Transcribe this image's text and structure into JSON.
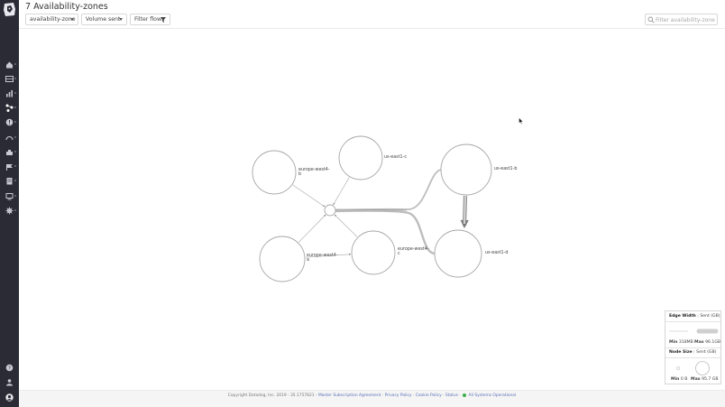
{
  "page": {
    "title": "7 Availability-zones"
  },
  "toolbar": {
    "group_by": "availability-zone",
    "metric": "Volume sent",
    "filter_label": "Filter flows",
    "search_placeholder": "Filter availability-zones"
  },
  "sidebar": {
    "icons": [
      "home-icon",
      "monitor-icon",
      "dashboard-icon",
      "network-icon",
      "security-icon",
      "apm-icon",
      "integrations-icon",
      "synthetics-icon",
      "logs-icon",
      "notebooks-icon",
      "settings-icon"
    ],
    "bottom_icons": [
      "help-icon",
      "team-icon",
      "user-icon"
    ]
  },
  "graph": {
    "nodes": [
      {
        "name": "europe-west4-b",
        "label_lines": [
          "europe-west4-",
          "b"
        ]
      },
      {
        "name": "us-east1-c",
        "label_lines": [
          "us-east1-c"
        ]
      },
      {
        "name": "us-east1-b",
        "label_lines": [
          "us-east1-b"
        ]
      },
      {
        "name": "europe-west4-a",
        "label_lines": [
          "europe-west4-",
          "a"
        ]
      },
      {
        "name": "europe-west4-c",
        "label_lines": [
          "europe-west4-",
          "c"
        ]
      },
      {
        "name": "us-east1-d",
        "label_lines": [
          "us-east1-d"
        ]
      },
      {
        "name": "hub",
        "label_lines": []
      }
    ]
  },
  "legend": {
    "edge_title": "Edge Width",
    "edge_unit": "Sent (GB)",
    "edge_min_label": "Min",
    "edge_min": "318MB",
    "edge_max_label": "Max",
    "edge_max": "96.1GB",
    "node_title": "Node Size",
    "node_unit": "Sent (GB)",
    "node_min_label": "Min",
    "node_min": "0 B",
    "node_max_label": "Max",
    "node_max": "95.7 GB"
  },
  "footer": {
    "copyright": "Copyright Datadog, Inc. 2019 - 35.1757821 -",
    "msa": "Master Subscription Agreement",
    "sep1": "·",
    "privacy": "Privacy Policy",
    "sep2": "·",
    "cookie": "Cookie Policy",
    "sep3": "·",
    "status": "Status",
    "sep4": "·",
    "systems": "All Systems Operational"
  },
  "colors": {
    "sidebar_bg": "#2b2b36",
    "accent_link": "#5a70b8",
    "status_ok": "#3cae4a"
  }
}
